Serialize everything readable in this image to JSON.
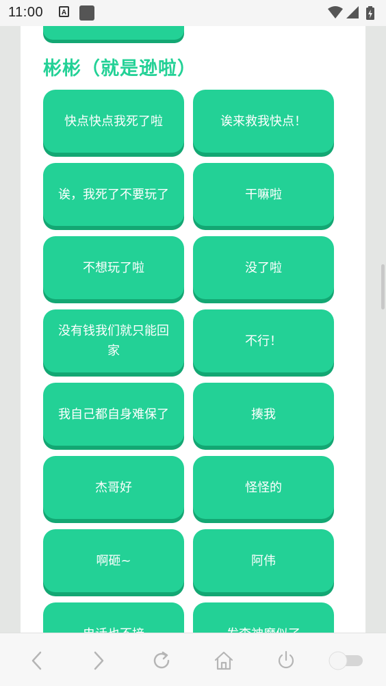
{
  "status_bar": {
    "time": "11:00",
    "notification_icon_letter": "A",
    "icons": [
      "wifi-icon",
      "signal-icon",
      "battery-icon"
    ]
  },
  "section": {
    "title": "彬彬（就是逊啦）"
  },
  "buttons": [
    {
      "label": "快点快点我死了啦"
    },
    {
      "label": "诶来救我快点！"
    },
    {
      "label": "诶，我死了不要玩了"
    },
    {
      "label": "干嘛啦"
    },
    {
      "label": "不想玩了啦"
    },
    {
      "label": "没了啦"
    },
    {
      "label": "没有钱我们就只能回家"
    },
    {
      "label": "不行！"
    },
    {
      "label": "我自己都自身难保了"
    },
    {
      "label": "揍我"
    },
    {
      "label": "杰哥好"
    },
    {
      "label": "怪怪的"
    },
    {
      "label": "啊砸~"
    },
    {
      "label": "阿伟"
    },
    {
      "label": "电话也不接"
    },
    {
      "label": "发李神魔似了"
    }
  ],
  "nav_bar": {
    "items": [
      "back-icon",
      "forward-icon",
      "refresh-icon",
      "home-icon",
      "power-icon",
      "toggle-switch"
    ]
  },
  "colors": {
    "accent": "#23d196",
    "accent_shadow": "#13a773",
    "background": "#ffffff"
  }
}
